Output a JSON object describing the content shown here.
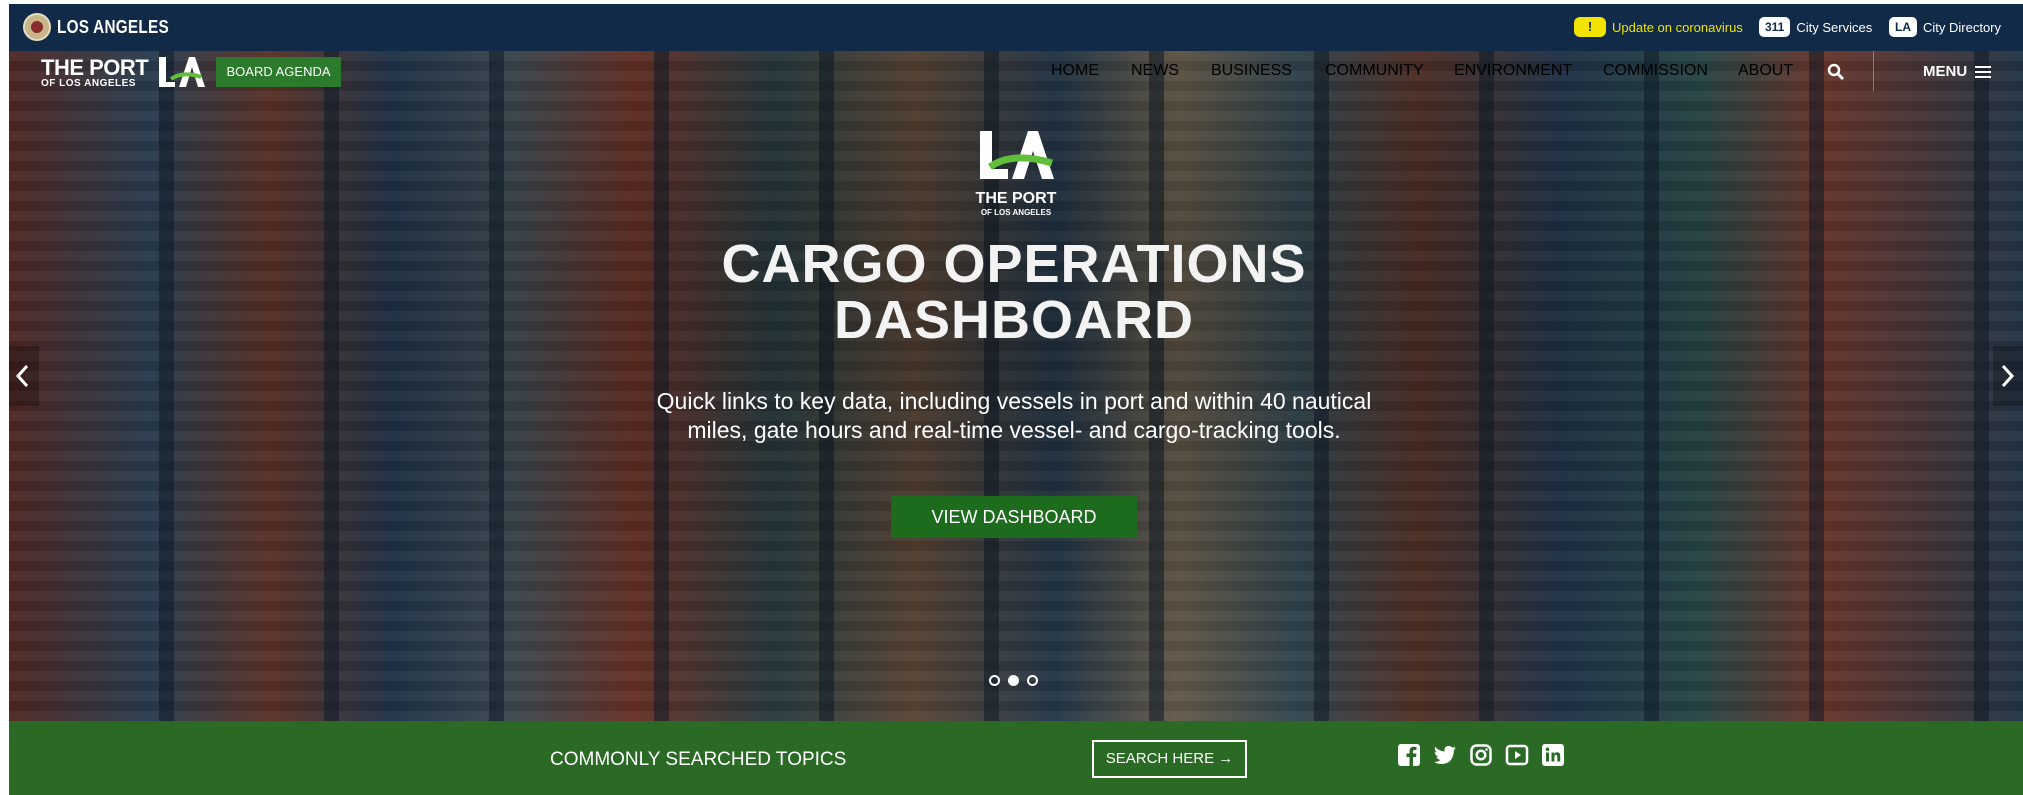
{
  "citybar": {
    "city_name": "LOS ANGELES",
    "alert_icon": "!",
    "alert_text": "Update on coronavirus",
    "services_pill": "311",
    "services_label": "City Services",
    "directory_pill": "LA",
    "directory_label": "City Directory"
  },
  "brand": {
    "line1": "THE PORT",
    "line2": "OF LOS ANGELES",
    "board_agenda": "BOARD AGENDA"
  },
  "nav": {
    "items": [
      "HOME",
      "NEWS",
      "BUSINESS",
      "COMMUNITY",
      "ENVIRONMENT",
      "COMMISSION",
      "ABOUT"
    ],
    "menu_label": "MENU"
  },
  "hero": {
    "logo_line1": "THE PORT",
    "logo_line2": "OF LOS ANGELES",
    "title": "CARGO OPERATIONS DASHBOARD",
    "subtitle": "Quick links to key data, including vessels in port and within 40 nautical miles, gate hours and real-time vessel- and cargo-tracking tools.",
    "cta_label": "VIEW DASHBOARD",
    "slides_total": 3,
    "active_slide": 2
  },
  "footer": {
    "topics_label": "COMMONLY SEARCHED TOPICS",
    "search_label": "SEARCH HERE →",
    "social_icons": [
      "facebook-icon",
      "twitter-icon",
      "instagram-icon",
      "youtube-icon",
      "linkedin-icon"
    ]
  },
  "colors": {
    "citybar_bg": "#102a47",
    "accent_green": "#2c7a2c",
    "alert_yellow": "#f2e400",
    "footer_green": "#2a6a25"
  }
}
